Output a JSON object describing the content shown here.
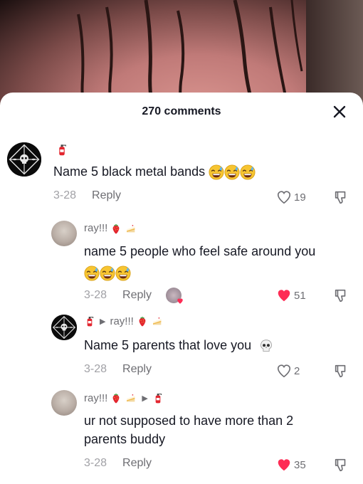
{
  "header": {
    "title": "270 comments"
  },
  "comments": [
    {
      "text": "Name 5 black metal bands",
      "date": "3-28",
      "reply_label": "Reply",
      "likes": "19"
    },
    {
      "username": "ray!!!",
      "text_line1": "name 5 people who feel safe around you",
      "date": "3-28",
      "reply_label": "Reply",
      "likes": "51"
    },
    {
      "username": "ray!!!",
      "text": "Name 5 parents that love you",
      "date": "3-28",
      "reply_label": "Reply",
      "likes": "2"
    },
    {
      "username": "ray!!!",
      "text_line1": "ur not supposed to have more than 2",
      "text_line2": "parents buddy",
      "date": "3-28",
      "reply_label": "Reply",
      "likes": "35"
    }
  ],
  "colors": {
    "liked": "#fe2c55",
    "muted": "#6e6e73",
    "date": "#a1a1a6"
  },
  "icons": [
    "close-icon",
    "heart-icon",
    "dislike-icon",
    "fire-extinguisher-icon",
    "strawberry-emoji",
    "cake-emoji",
    "sweat-smile-emoji",
    "skull-emoji",
    "caret-right-icon"
  ]
}
